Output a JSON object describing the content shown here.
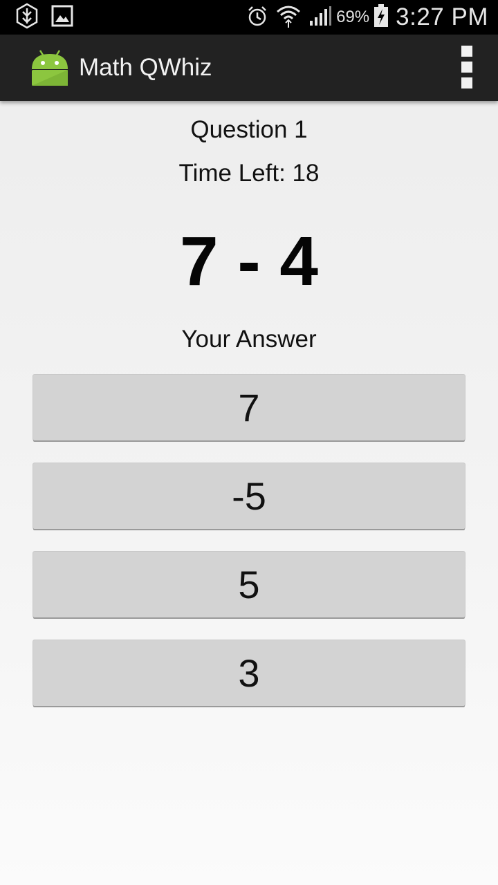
{
  "status_bar": {
    "icons_left": [
      "app-notification-icon",
      "gallery-icon"
    ],
    "icons_right": [
      "alarm-icon",
      "wifi-icon",
      "signal-icon",
      "battery-charging-icon"
    ],
    "battery_percent": "69%",
    "time": "3:27 PM"
  },
  "action_bar": {
    "title": "Math QWhiz",
    "logo_icon": "android-icon",
    "menu_icon": "overflow-menu-icon"
  },
  "quiz": {
    "question_label": "Question 1",
    "time_left": "Time Left: 18",
    "problem": "7 - 4",
    "answer_prompt": "Your Answer",
    "answers": [
      "7",
      "-5",
      "5",
      "3"
    ]
  },
  "colors": {
    "status_bar_bg": "#000000",
    "action_bar_bg": "#222222",
    "android_green": "#8cc63f",
    "button_bg": "#d3d3d3"
  }
}
